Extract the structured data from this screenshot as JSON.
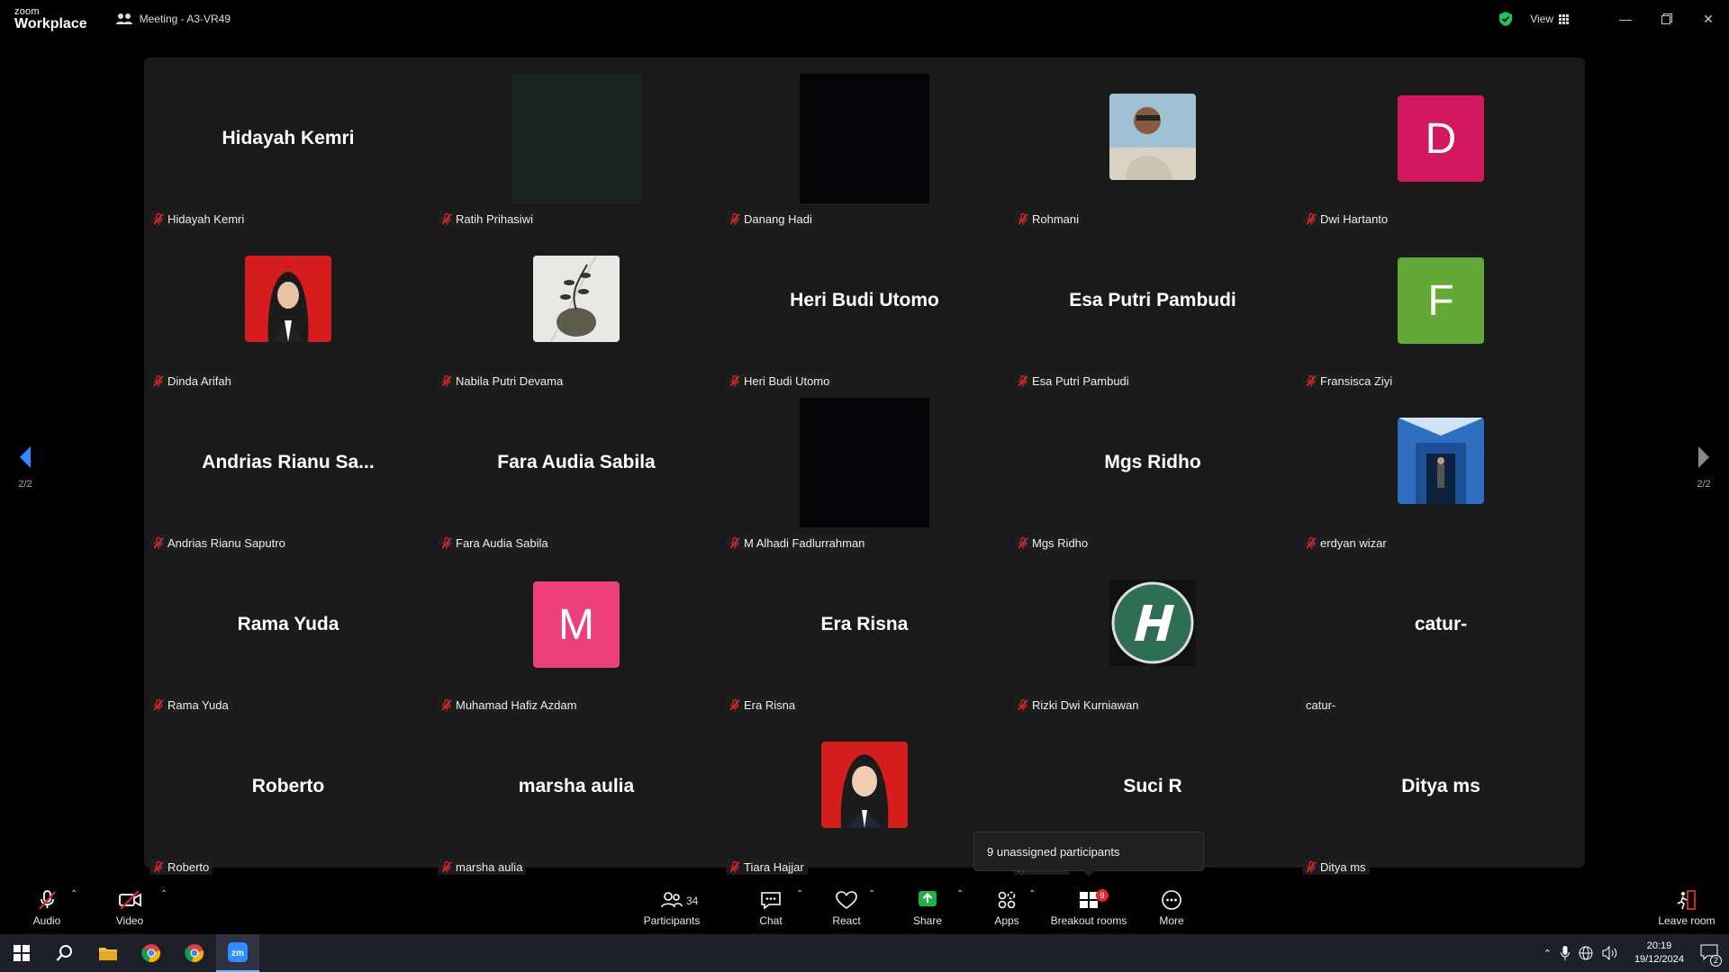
{
  "app": {
    "brand_small": "zoom",
    "brand_large": "Workplace",
    "meeting_title": "Meeting - A3-VR49",
    "view_label": "View"
  },
  "colors": {
    "accent_blue": "#2d8cff",
    "share_green": "#1fb141",
    "badge_red": "#e02828",
    "shield_green": "#19c85a"
  },
  "pager": {
    "left": "2/2",
    "right": "2/2"
  },
  "participants": [
    {
      "name": "Hidayah Kemri",
      "display": "Hidayah Kemri",
      "type": "name",
      "muted": true
    },
    {
      "name": "Ratih Prihasiwi",
      "display": "",
      "type": "video-dark-green",
      "muted": true
    },
    {
      "name": "Danang Hadi",
      "display": "",
      "type": "video-black",
      "muted": true
    },
    {
      "name": "Rohmani",
      "display": "",
      "type": "photo-man",
      "muted": true
    },
    {
      "name": "Dwi Hartanto",
      "display": "D",
      "type": "letter",
      "color": "#d2185f",
      "muted": true
    },
    {
      "name": "Dinda Arifah",
      "display": "",
      "type": "photo-hijab-red",
      "muted": true
    },
    {
      "name": "Nabila Putri Devama",
      "display": "",
      "type": "photo-plant",
      "muted": true
    },
    {
      "name": "Heri Budi Utomo",
      "display": "Heri Budi Utomo",
      "type": "name",
      "muted": true
    },
    {
      "name": "Esa Putri Pambudi",
      "display": "Esa Putri Pambudi",
      "type": "name",
      "muted": true
    },
    {
      "name": "Fransisca Ziyi",
      "display": "F",
      "type": "letter",
      "color": "#64a836",
      "muted": true
    },
    {
      "name": "Andrias Rianu Saputro",
      "display": "Andrias Rianu Sa...",
      "type": "name",
      "muted": true
    },
    {
      "name": "Fara Audia Sabila",
      "display": "Fara Audia Sabila",
      "type": "name",
      "muted": true
    },
    {
      "name": "M Alhadi Fadlurrahman",
      "display": "",
      "type": "video-black",
      "muted": true
    },
    {
      "name": "Mgs Ridho",
      "display": "Mgs Ridho",
      "type": "name",
      "muted": true
    },
    {
      "name": "erdyan wizar",
      "display": "",
      "type": "photo-building",
      "muted": true
    },
    {
      "name": "Rama Yuda",
      "display": "Rama Yuda",
      "type": "name",
      "muted": true
    },
    {
      "name": "Muhamad Hafiz Azdam",
      "display": "M",
      "type": "letter",
      "color": "#ec3f7b",
      "muted": true
    },
    {
      "name": "Era Risna",
      "display": "Era Risna",
      "type": "name",
      "muted": true
    },
    {
      "name": "Rizki Dwi Kurniawan",
      "display": "",
      "type": "photo-logo",
      "muted": true
    },
    {
      "name": "catur-",
      "display": "catur-",
      "type": "name",
      "muted": false
    },
    {
      "name": "Roberto",
      "display": "Roberto",
      "type": "name",
      "muted": true
    },
    {
      "name": "marsha aulia",
      "display": "marsha aulia",
      "type": "name",
      "muted": true
    },
    {
      "name": "Tiara Hajjar",
      "display": "",
      "type": "photo-hijab-red2",
      "muted": true
    },
    {
      "name": "Suci R",
      "display": "Suci R",
      "type": "name",
      "muted": true
    },
    {
      "name": "Ditya ms",
      "display": "Ditya ms",
      "type": "name",
      "muted": true
    }
  ],
  "tooltip": {
    "text": "9 unassigned participants"
  },
  "toolbar": {
    "audio": "Audio",
    "video": "Video",
    "participants": "Participants",
    "participants_count": "34",
    "chat": "Chat",
    "react": "React",
    "share": "Share",
    "apps": "Apps",
    "breakout": "Breakout rooms",
    "breakout_badge": "9",
    "more": "More",
    "leave": "Leave room"
  },
  "taskbar": {
    "time": "20:19",
    "date": "19/12/2024",
    "notifications": "2"
  }
}
